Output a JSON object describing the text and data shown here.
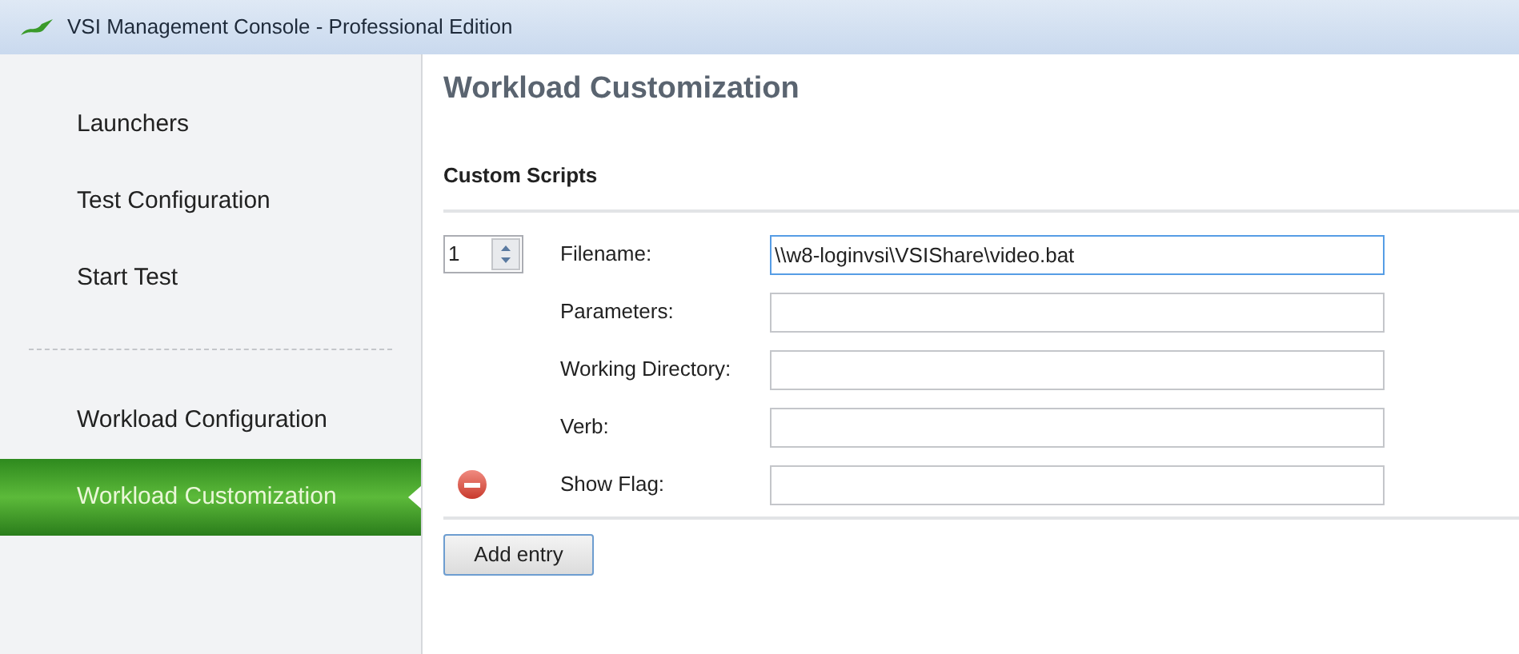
{
  "window": {
    "title": "VSI Management Console - Professional Edition"
  },
  "sidebar": {
    "groups": [
      [
        {
          "label": "Launchers",
          "selected": false
        },
        {
          "label": "Test Configuration",
          "selected": false
        },
        {
          "label": "Start Test",
          "selected": false
        }
      ],
      [
        {
          "label": "Workload Configuration",
          "selected": false
        },
        {
          "label": "Workload Customization",
          "selected": true
        }
      ]
    ]
  },
  "page": {
    "title": "Workload Customization",
    "section": "Custom Scripts",
    "entry": {
      "index": "1",
      "fields": [
        {
          "label": "Filename:",
          "value": "\\\\w8-loginvsi\\VSIShare\\video.bat",
          "focused": true
        },
        {
          "label": "Parameters:",
          "focused": false
        },
        {
          "label": "Working Directory:",
          "focused": false
        },
        {
          "label": "Verb:",
          "focused": false
        },
        {
          "label": "Show Flag:",
          "focused": false
        }
      ]
    },
    "add_button": "Add entry"
  }
}
